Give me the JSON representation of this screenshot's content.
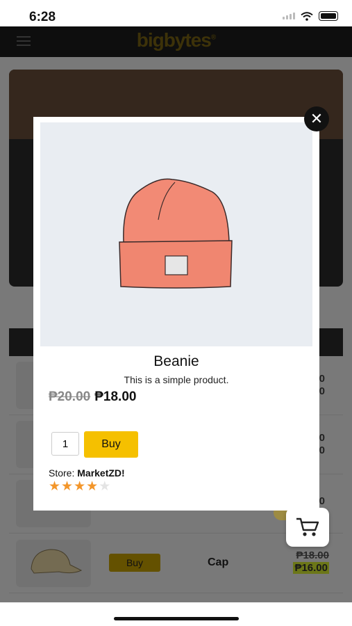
{
  "status": {
    "time": "6:28"
  },
  "app": {
    "logo": "bigbytes",
    "logo_mark": "®"
  },
  "background_table": {
    "rows": [
      {
        "frag_top": "0",
        "frag_bottom": "0"
      },
      {
        "frag_top": "0",
        "frag_bottom": "0"
      },
      {
        "frag_top": "0",
        "frag_bottom": ""
      },
      {
        "buy_label": "Buy",
        "name": "Cap",
        "old_price": "₱18.00",
        "new_price": "₱16.00"
      }
    ]
  },
  "modal": {
    "close_icon": "close-icon",
    "product_image": "beanie-illustration",
    "title": "Beanie",
    "description": "This is a simple product.",
    "old_price": "₱20.00",
    "new_price": "₱18.00",
    "quantity": "1",
    "buy_label": "Buy",
    "store_label": "Store:",
    "store_name": "MarketZD!",
    "rating": 4,
    "rating_max": 5
  },
  "colors": {
    "accent": "#f5c000",
    "star": "#f3962a",
    "price_highlight": "#d9ef30"
  }
}
